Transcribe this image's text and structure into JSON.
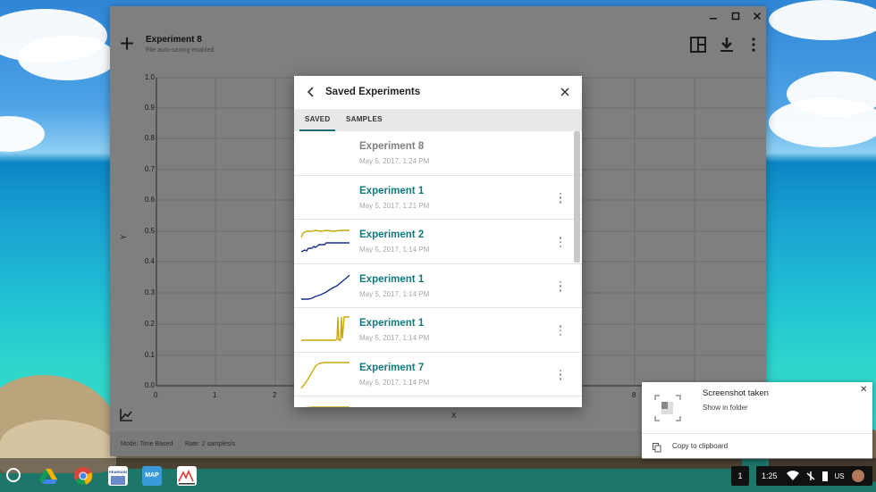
{
  "app": {
    "title": "Experiment 8",
    "subtitle": "File auto-saving enabled"
  },
  "window_controls": [
    "minimize-icon",
    "maximize-icon",
    "close-icon"
  ],
  "toolbar": {
    "add_icon": "plus-icon",
    "layout_icon": "panel-layout-icon",
    "download_icon": "download-icon",
    "more_icon": "more-vert-icon"
  },
  "graph": {
    "ylabel": "Y",
    "xlabel": "X",
    "y_ticks": [
      "1.0",
      "0.9",
      "0.8",
      "0.7",
      "0.6",
      "0.5",
      "0.4",
      "0.3",
      "0.2",
      "0.1",
      "0.0"
    ],
    "x_ticks": [
      "0",
      "1",
      "2",
      "8"
    ],
    "tool_icon": "graph-settings-icon"
  },
  "status": {
    "mode": "Mode: Time Based",
    "rate": "Rate: 2 samples/s"
  },
  "dialog": {
    "title": "Saved Experiments",
    "tabs": [
      "SAVED",
      "SAMPLES"
    ],
    "active_tab": "SAVED",
    "experiments": [
      {
        "name": "Experiment 8",
        "date": "May 5, 2017, 1:24 PM",
        "active": false,
        "thumb": "none"
      },
      {
        "name": "Experiment 1",
        "date": "May 5, 2017, 1:21 PM",
        "active": true,
        "thumb": "none"
      },
      {
        "name": "Experiment 2",
        "date": "May 5, 2017, 1:14 PM",
        "active": true,
        "thumb": "dual"
      },
      {
        "name": "Experiment 1",
        "date": "May 5, 2017, 1:14 PM",
        "active": true,
        "thumb": "rising"
      },
      {
        "name": "Experiment 1",
        "date": "May 5, 2017, 1:14 PM",
        "active": true,
        "thumb": "spike"
      },
      {
        "name": "Experiment 7",
        "date": "May 5, 2017, 1:14 PM",
        "active": true,
        "thumb": "plateau"
      },
      {
        "name": "",
        "date": "",
        "active": true,
        "thumb": "partial"
      }
    ]
  },
  "notification": {
    "title": "Screenshot taken",
    "link": "Show in folder",
    "action": "Copy to clipboard"
  },
  "shelf": {
    "apps": [
      "drive-icon",
      "chrome-icon",
      "pearson-icon",
      "map-icon",
      "science-journal-icon"
    ],
    "pearson_label": "PEARSON",
    "map_label": "MAP",
    "notification_count": "1",
    "time": "1:25",
    "locale": "US"
  },
  "colors": {
    "teal": "#137a7f",
    "gold": "#c9a90a",
    "navy": "#1a2f8a"
  }
}
